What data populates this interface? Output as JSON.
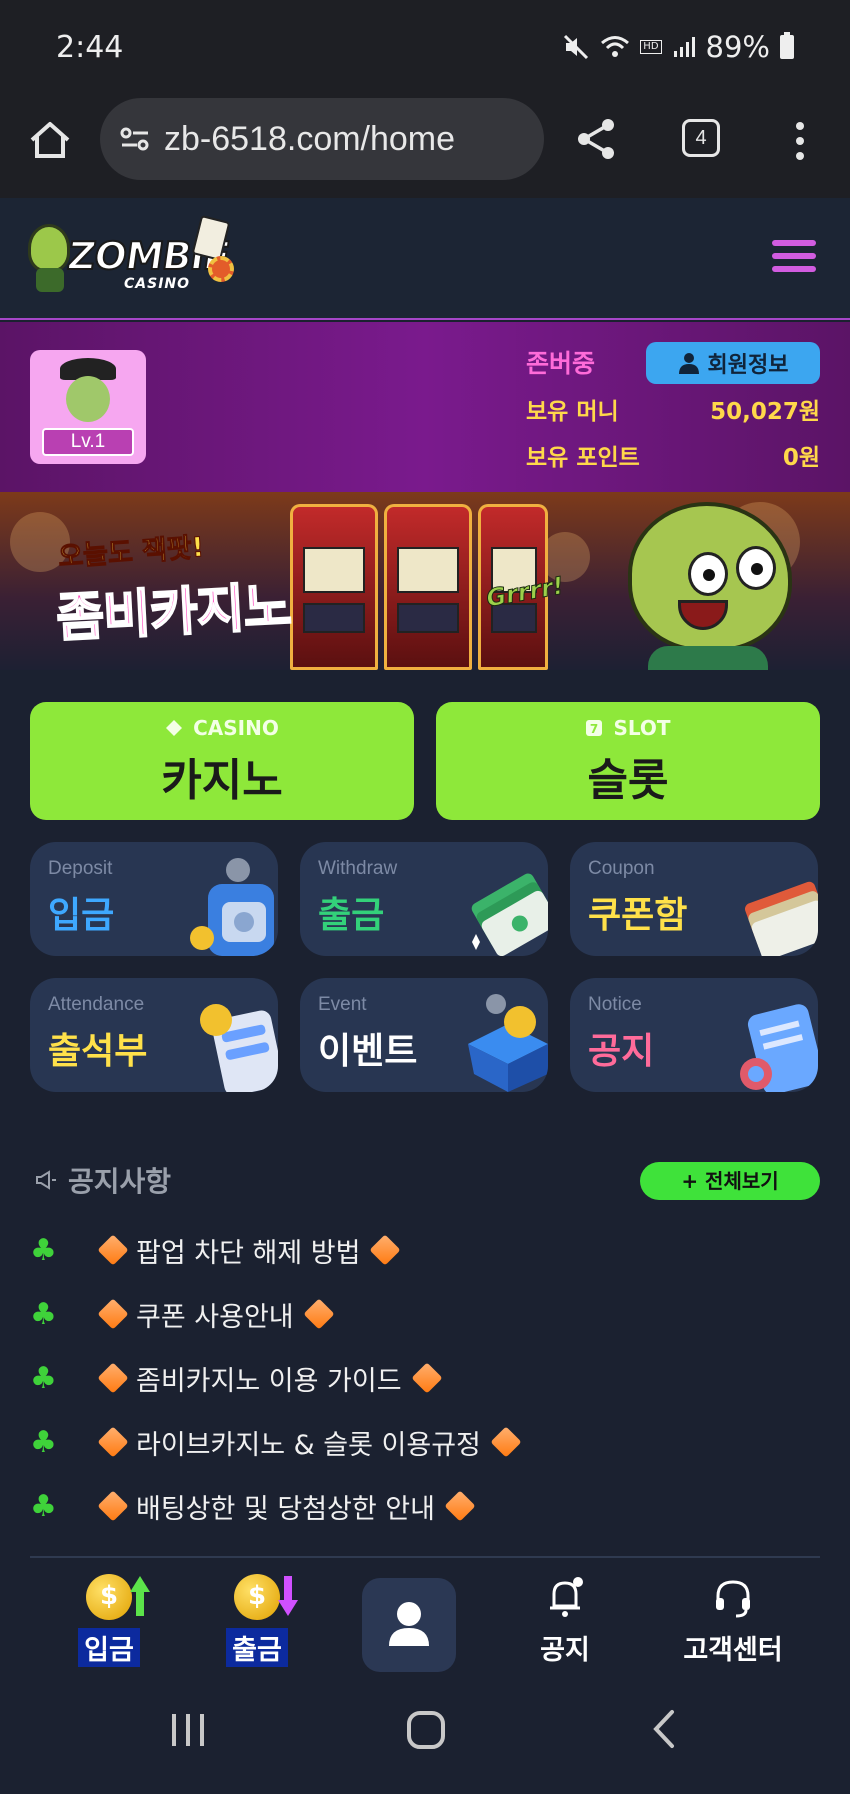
{
  "status_bar": {
    "time": "2:44",
    "battery": "89%",
    "hd_label": "HD"
  },
  "browser": {
    "url": "zb-6518.com/home",
    "tab_count": "4"
  },
  "site": {
    "logo_text": "ZOMBIE",
    "logo_sub": "CASINO"
  },
  "member": {
    "level": "Lv.1",
    "name": "존버중",
    "info_button": "회원정보",
    "money_label": "보유 머니",
    "money_value": "50,027원",
    "points_label": "보유 포인트",
    "points_value": "0원"
  },
  "banner": {
    "small_text": "오늘도 잭팟!",
    "big_text": "좀비카지노",
    "grrr_text": "Grrrr!"
  },
  "games": [
    {
      "en": "CASINO",
      "ko": "카지노",
      "icon": "diamond-icon"
    },
    {
      "en": "SLOT",
      "ko": "슬롯",
      "icon": "slot-seven-icon"
    }
  ],
  "tiles": [
    {
      "en": "Deposit",
      "ko": "입금",
      "color": "#3ea8ff"
    },
    {
      "en": "Withdraw",
      "ko": "출금",
      "color": "#33d17a"
    },
    {
      "en": "Coupon",
      "ko": "쿠폰함",
      "color": "#ffe14a"
    },
    {
      "en": "Attendance",
      "ko": "출석부",
      "color": "#ffe14a"
    },
    {
      "en": "Event",
      "ko": "이벤트",
      "color": "#ffffff"
    },
    {
      "en": "Notice",
      "ko": "공지",
      "color": "#ff6b9a"
    }
  ],
  "notice": {
    "title": "공지사항",
    "view_all": "+ 전체보기",
    "items": [
      "팝업 차단 해제 방법",
      "쿠폰 사용안내",
      "좀비카지노 이용 가이드",
      "라이브카지노 & 슬롯 이용규정",
      "배팅상한 및 당첨상한 안내"
    ]
  },
  "bottom_nav": {
    "deposit": "입금",
    "withdraw": "출금",
    "notice": "공지",
    "support": "고객센터"
  }
}
